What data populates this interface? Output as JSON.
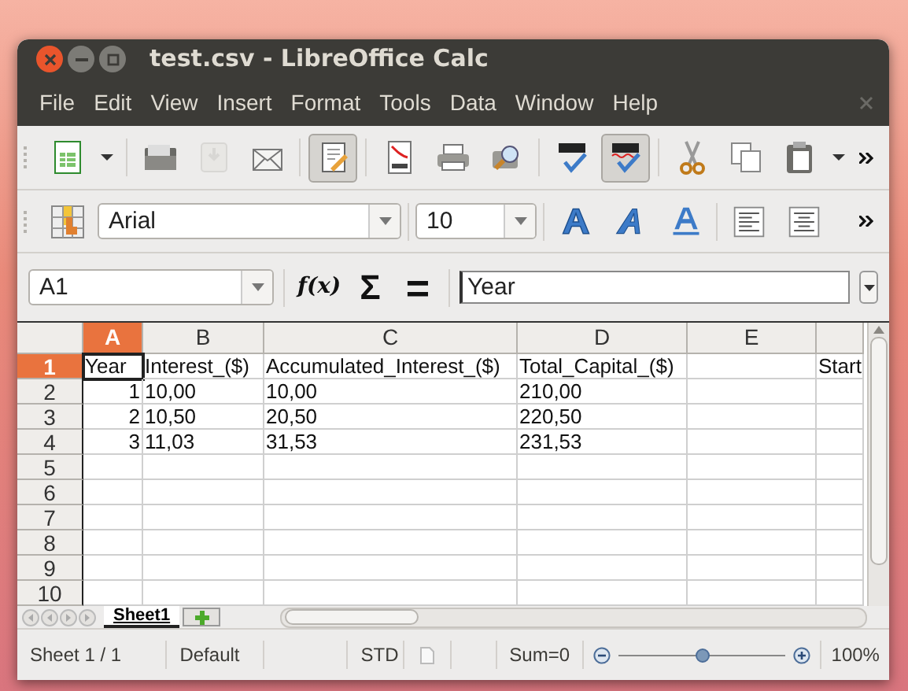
{
  "window": {
    "title": "test.csv - LibreOffice Calc"
  },
  "menu": [
    "File",
    "Edit",
    "View",
    "Insert",
    "Format",
    "Tools",
    "Data",
    "Window",
    "Help"
  ],
  "toolbar": [
    {
      "kind": "new",
      "pressed": false,
      "disabled": false
    },
    {
      "kind": "dropdown",
      "pressed": false,
      "disabled": false
    },
    {
      "kind": "open",
      "pressed": false,
      "disabled": false
    },
    {
      "kind": "save",
      "pressed": false,
      "disabled": true
    },
    {
      "kind": "email",
      "pressed": false,
      "disabled": false
    },
    {
      "kind": "edit",
      "pressed": true,
      "disabled": false
    },
    {
      "kind": "pdf",
      "pressed": false,
      "disabled": false
    },
    {
      "kind": "print",
      "pressed": false,
      "disabled": false
    },
    {
      "kind": "preview",
      "pressed": false,
      "disabled": false
    },
    {
      "kind": "spell",
      "pressed": false,
      "disabled": false
    },
    {
      "kind": "autospell",
      "pressed": true,
      "disabled": false
    },
    {
      "kind": "cut",
      "pressed": false,
      "disabled": false
    },
    {
      "kind": "copy",
      "pressed": false,
      "disabled": false
    },
    {
      "kind": "paste",
      "pressed": false,
      "disabled": false
    },
    {
      "kind": "dropdown",
      "pressed": false,
      "disabled": false
    }
  ],
  "formatting": {
    "font": "Arial",
    "size": "10",
    "buttons": [
      {
        "kind": "bold",
        "pressed": false
      },
      {
        "kind": "italic",
        "pressed": false
      },
      {
        "kind": "underline",
        "pressed": false
      },
      {
        "kind": "align-left",
        "pressed": false
      },
      {
        "kind": "align-center",
        "pressed": false
      }
    ]
  },
  "formula_bar": {
    "name_box": "A1",
    "function_wizard": "f(x)",
    "sum": "Σ",
    "equals": "=",
    "value": "Year"
  },
  "grid": {
    "columns": [
      {
        "header": "A",
        "selected": true
      },
      {
        "header": "B",
        "selected": false
      },
      {
        "header": "C",
        "selected": false
      },
      {
        "header": "D",
        "selected": false
      },
      {
        "header": "E",
        "selected": false
      },
      {
        "selected": false
      }
    ],
    "rows": [
      {
        "header": "1",
        "selected": true,
        "cells": [
          {
            "text": "Year",
            "kind": "text",
            "selected": true
          },
          {
            "text": "Interest_($)",
            "kind": "text",
            "selected": false
          },
          {
            "text": "Accumulated_Interest_($)",
            "kind": "text",
            "selected": false
          },
          {
            "text": "Total_Capital_($)",
            "kind": "text",
            "selected": false
          },
          null,
          {
            "text": "Start",
            "kind": "text",
            "selected": false
          }
        ]
      },
      {
        "header": "2",
        "selected": false,
        "cells": [
          {
            "text": "1",
            "kind": "number",
            "selected": false
          },
          {
            "text": "10,00",
            "kind": "text",
            "selected": false
          },
          {
            "text": "10,00",
            "kind": "text",
            "selected": false
          },
          {
            "text": "210,00",
            "kind": "text",
            "selected": false
          }
        ]
      },
      {
        "header": "3",
        "selected": false,
        "cells": [
          {
            "text": "2",
            "kind": "number",
            "selected": false
          },
          {
            "text": "10,50",
            "kind": "text",
            "selected": false
          },
          {
            "text": "20,50",
            "kind": "text",
            "selected": false
          },
          {
            "text": "220,50",
            "kind": "text",
            "selected": false
          }
        ]
      },
      {
        "header": "4",
        "selected": false,
        "cells": [
          {
            "text": "3",
            "kind": "number",
            "selected": false
          },
          {
            "text": "11,03",
            "kind": "text",
            "selected": false
          },
          {
            "text": "31,53",
            "kind": "text",
            "selected": false
          },
          {
            "text": "231,53",
            "kind": "text",
            "selected": false
          }
        ]
      },
      {
        "header": "5",
        "selected": false
      },
      {
        "header": "6",
        "selected": false
      },
      {
        "header": "7",
        "selected": false
      },
      {
        "header": "8",
        "selected": false
      },
      {
        "header": "9",
        "selected": false
      },
      {
        "header": "10",
        "selected": false
      }
    ]
  },
  "sheet_tabs": [
    {
      "label": "Sheet1",
      "selected": true
    }
  ],
  "status_bar": {
    "sheet": "Sheet 1 / 1",
    "page_style": "Default",
    "mode": "STD",
    "sum": "Sum=0",
    "zoom": {
      "level": 0.5
    },
    "zoom_label": "100%"
  }
}
